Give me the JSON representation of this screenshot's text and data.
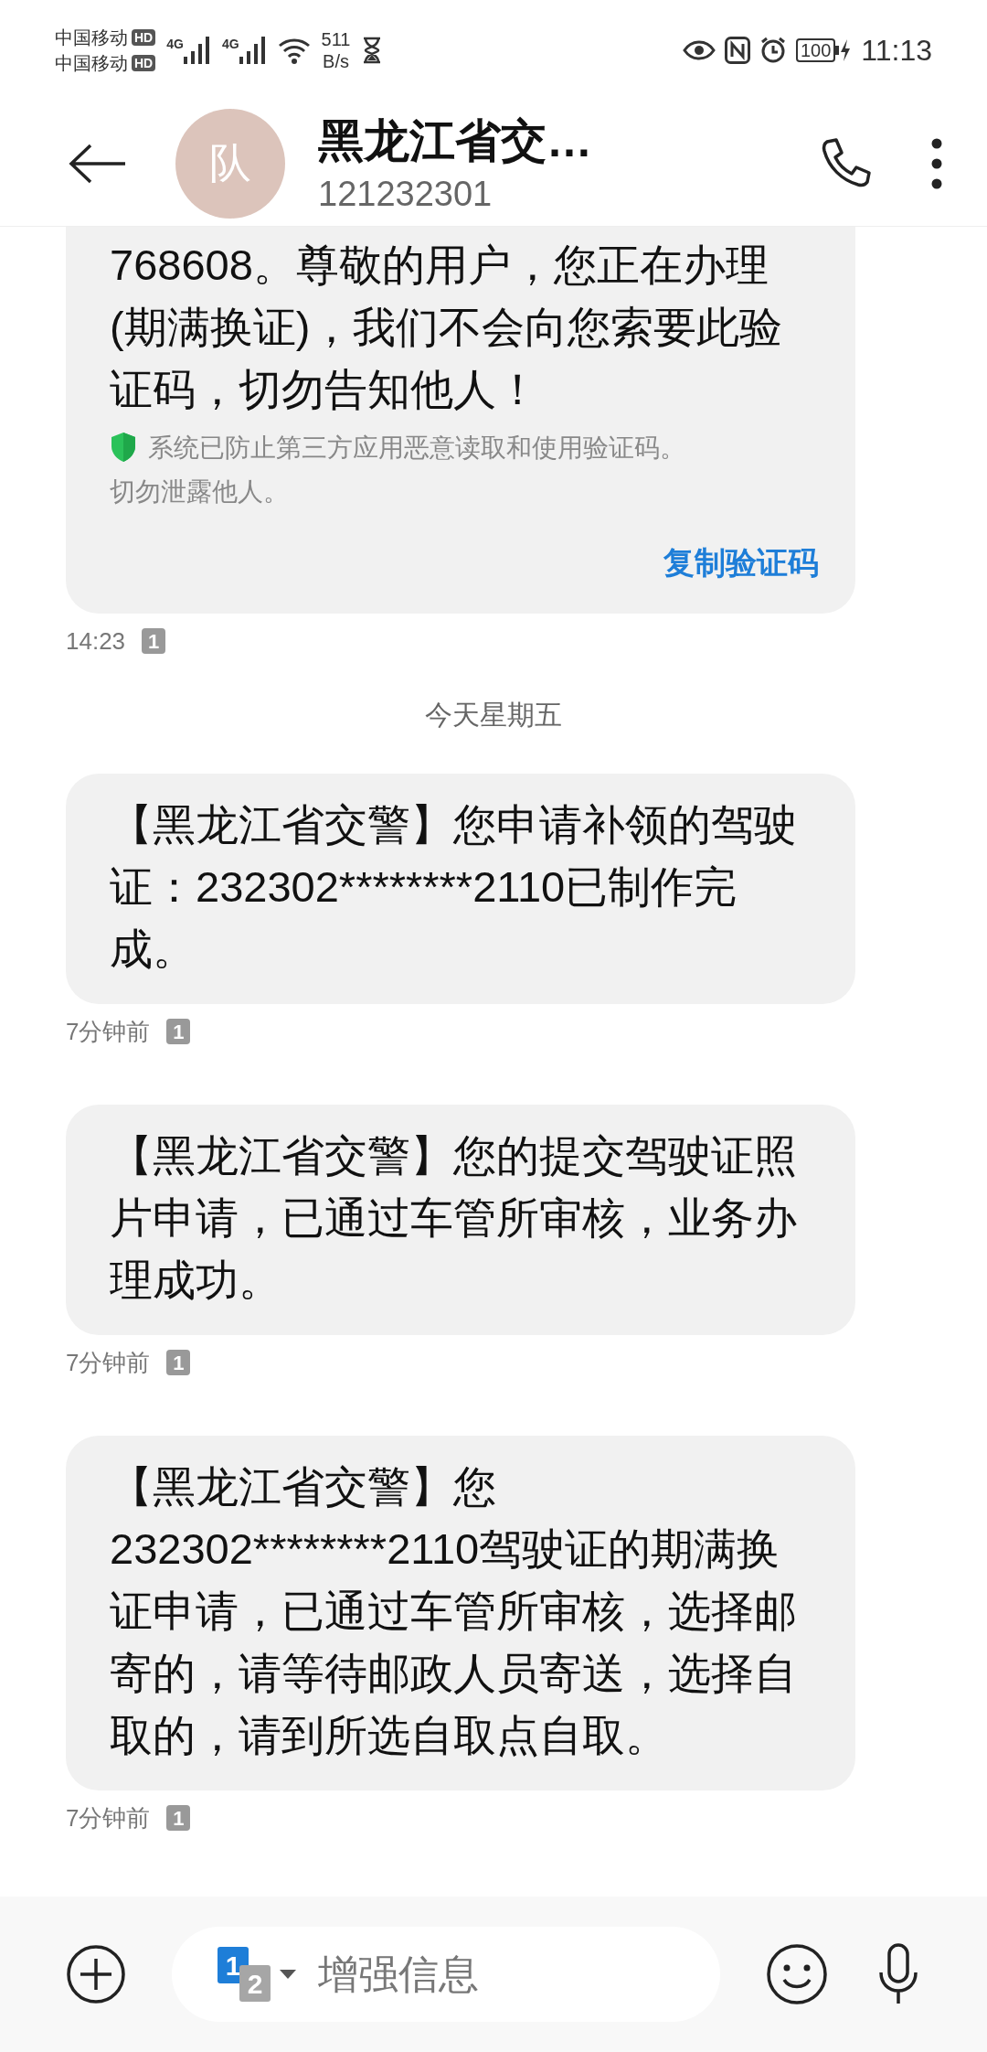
{
  "status_bar": {
    "carriers": [
      {
        "name": "中国移动",
        "badge": "HD"
      },
      {
        "name": "中国移动",
        "badge": "HD"
      }
    ],
    "network": [
      "4G",
      "4G"
    ],
    "speed": "511",
    "speed_unit": "B/s",
    "battery": "100",
    "time": "11:13"
  },
  "header": {
    "avatar": "队",
    "title": "黑龙江省交…",
    "number": "121232301"
  },
  "messages": [
    {
      "kind": "code",
      "text": "768608。尊敬的用户，您正在办理(期满换证)，我们不会向您索要此验证码，切勿告知他人！",
      "notice_lines": [
        "系统已防止第三方应用恶意读取和使用验证码。",
        "切勿泄露他人。"
      ],
      "action": "复制验证码",
      "time": "14:23",
      "sim": "1"
    },
    {
      "kind": "separator",
      "text": "今天星期五"
    },
    {
      "kind": "text",
      "text": "【黑龙江省交警】您申请补领的驾驶证：232302********2110已制作完成。",
      "time": "7分钟前",
      "sim": "1"
    },
    {
      "kind": "text",
      "text": "【黑龙江省交警】您的提交驾驶证照片申请，已通过车管所审核，业务办理成功。",
      "time": "7分钟前",
      "sim": "1"
    },
    {
      "kind": "text",
      "text": "【黑龙江省交警】您232302********2110驾驶证的期满换证申请，已通过车管所审核，选择邮寄的，请等待邮政人员寄送，选择自取的，请到所选自取点自取。",
      "time": "7分钟前",
      "sim": "1"
    }
  ],
  "composer": {
    "sim_primary": "1",
    "sim_secondary": "2",
    "placeholder": "增强信息"
  }
}
